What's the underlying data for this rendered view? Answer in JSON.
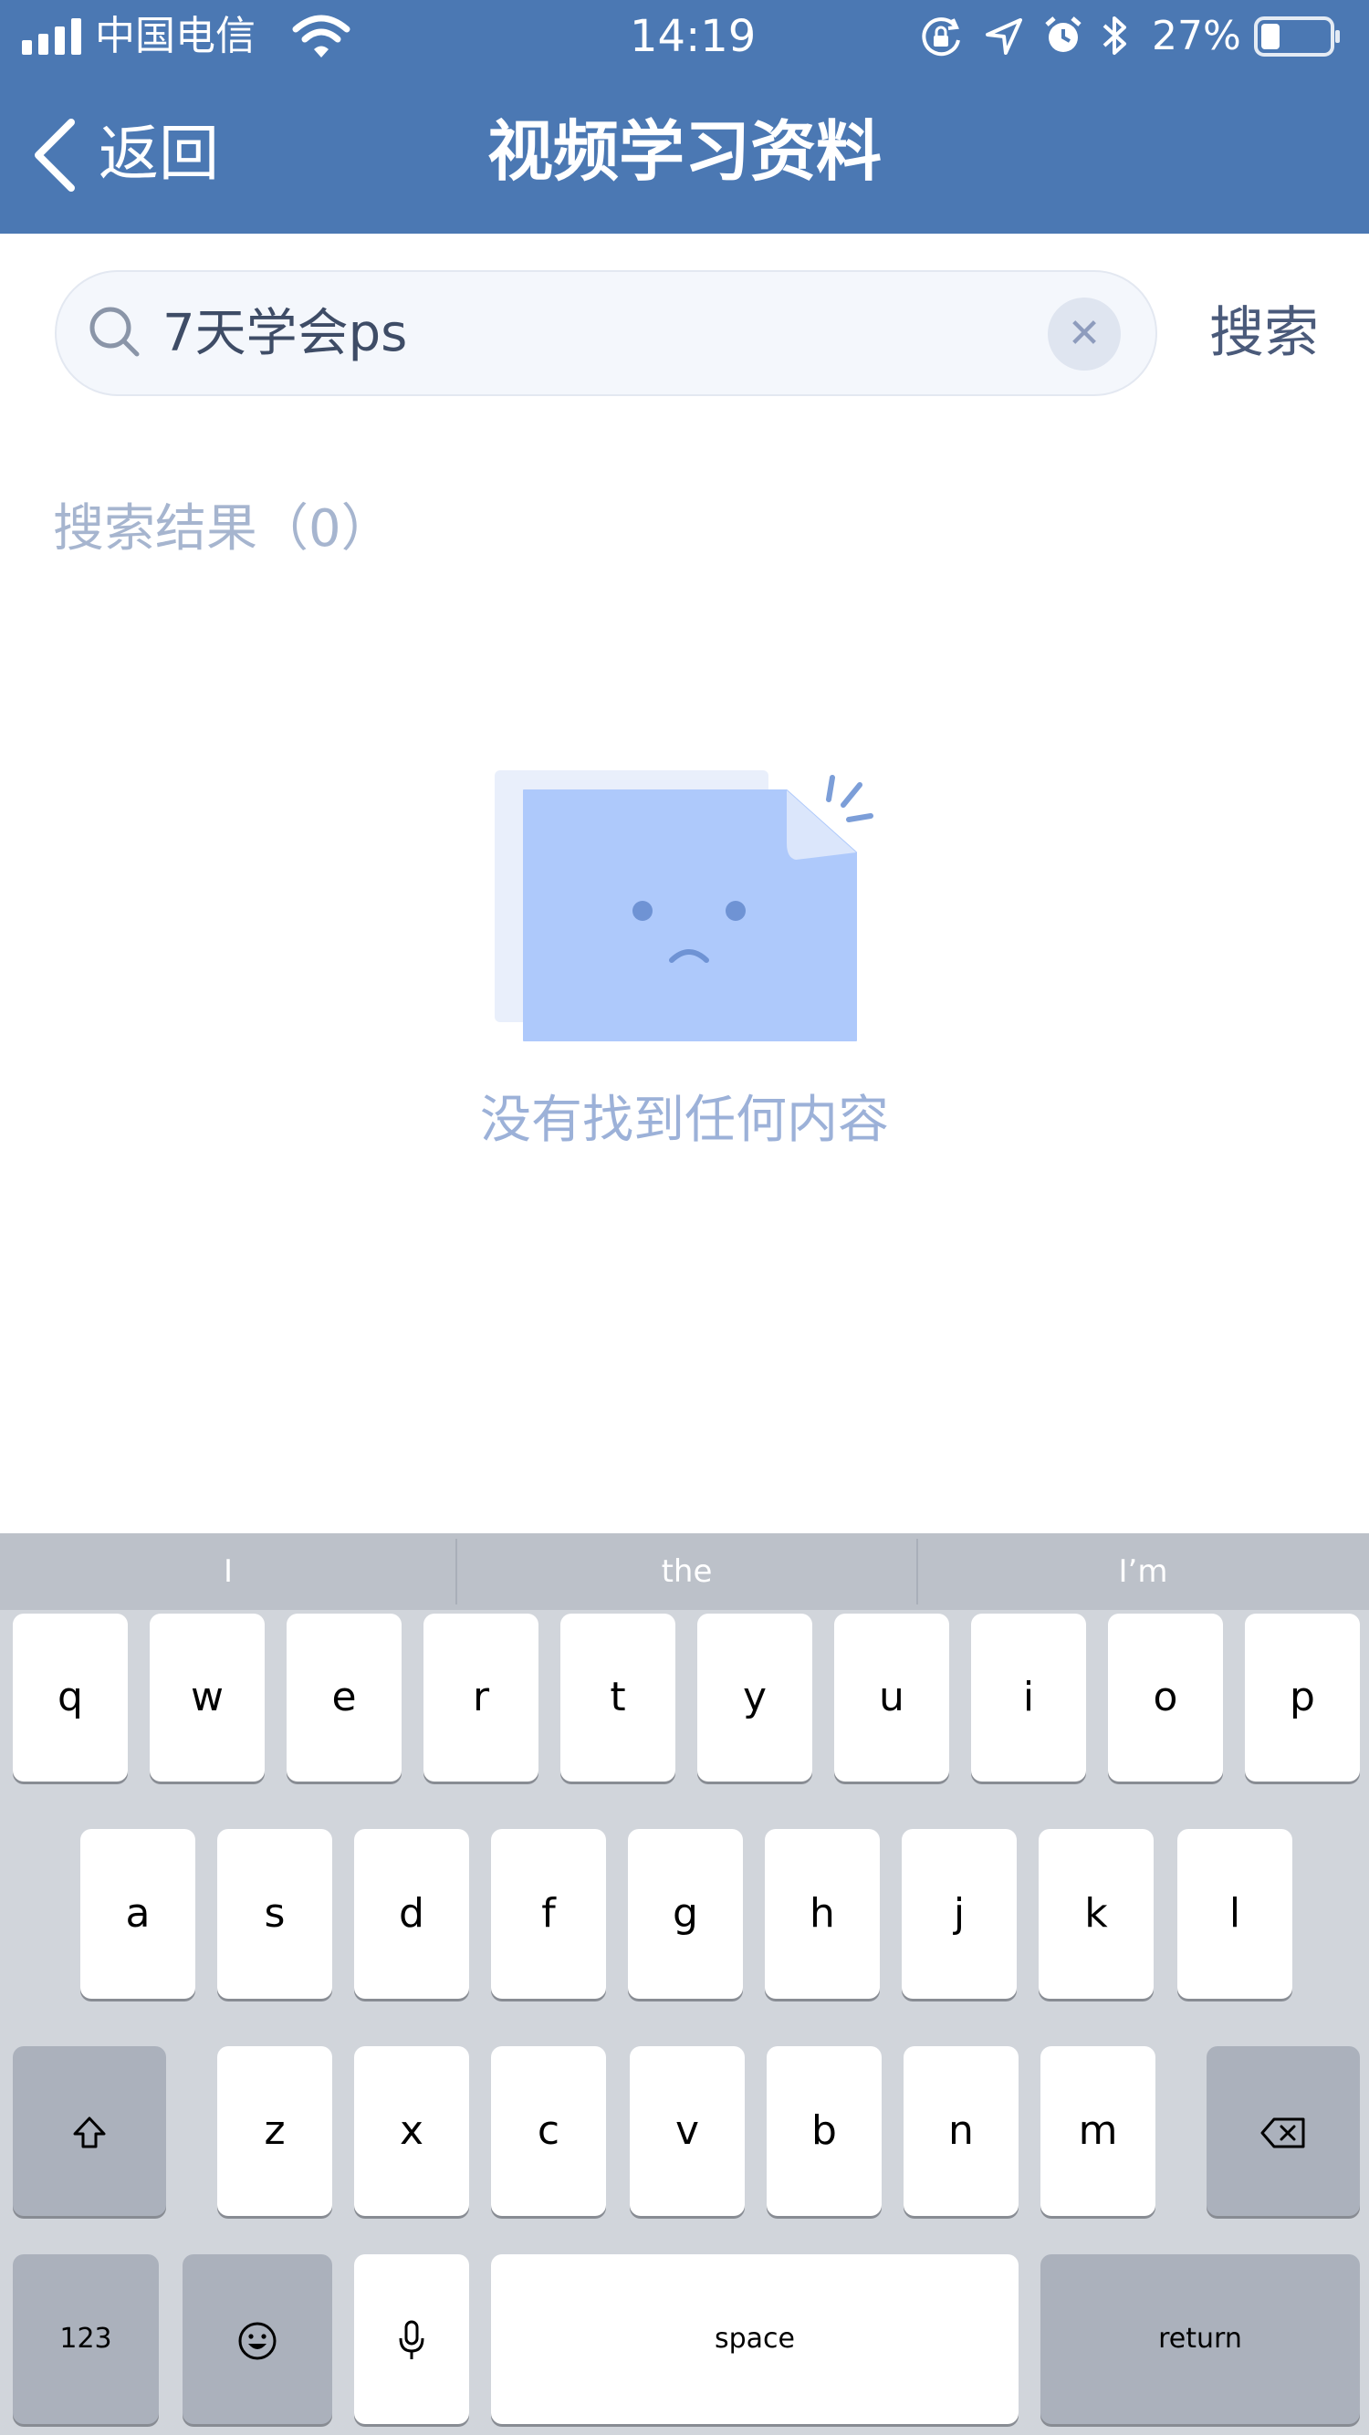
{
  "status_bar": {
    "carrier": "中国电信",
    "time": "14:19",
    "battery": "27%",
    "icons": [
      "signal-icon",
      "wifi-icon",
      "orientation-lock-icon",
      "location-icon",
      "alarm-icon",
      "bluetooth-icon",
      "battery-icon"
    ]
  },
  "nav": {
    "back_label": "返回",
    "title": "视频学习资料"
  },
  "search": {
    "value": "7天学会ps",
    "submit_label": "搜索",
    "clear_glyph": "✕"
  },
  "results": {
    "count_label": "搜索结果（0）"
  },
  "empty_state": {
    "message": "没有找到任何内容",
    "icon": "sad-document-icon"
  },
  "keyboard": {
    "suggestions": [
      "I",
      "the",
      "I’m"
    ],
    "row1": [
      "q",
      "w",
      "e",
      "r",
      "t",
      "y",
      "u",
      "i",
      "o",
      "p"
    ],
    "row2": [
      "a",
      "s",
      "d",
      "f",
      "g",
      "h",
      "j",
      "k",
      "l"
    ],
    "row3": [
      "z",
      "x",
      "c",
      "v",
      "b",
      "n",
      "m"
    ],
    "numbers_label": "123",
    "space_label": "space",
    "return_label": "return"
  },
  "colors": {
    "app_bar": "#4b78b3",
    "accent_text": "#4a5a7a",
    "muted_text": "#a6b5cf",
    "illustration": "#aec9fb"
  }
}
